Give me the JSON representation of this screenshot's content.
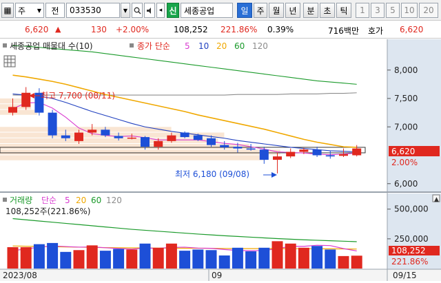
{
  "toolbar": {
    "market": "주",
    "prev_label": "전",
    "code": "033530",
    "new_label": "신",
    "stock_name": "세종공업",
    "periods": [
      "일",
      "주",
      "월",
      "년",
      "분",
      "초",
      "틱"
    ],
    "active_period": "일",
    "intervals": [
      "1",
      "3",
      "5",
      "10",
      "20"
    ]
  },
  "quote": {
    "price": "6,620",
    "change": "130",
    "change_pct": "+2.00%",
    "volume": "108,252",
    "volume_ratio": "221.86%",
    "turnover": "0.39%",
    "amount": "716백만",
    "ask_label": "호가",
    "ask_price": "6,620"
  },
  "price_panel": {
    "legend_name": "세종공업 매물대 수(10)",
    "ma_label": "종가 단순",
    "ma_periods": [
      "5",
      "10",
      "20",
      "60",
      "120"
    ],
    "high_annotation": "최고 7,700 (08/11)",
    "low_annotation": "최저 6,180 (09/08)",
    "y_ticks": [
      "8,000",
      "7,500",
      "7,000",
      "6,000"
    ],
    "current_price_tag": "6,620",
    "current_pct_tag": "2.00%"
  },
  "volume_panel": {
    "legend_name": "거래량",
    "ma_label": "단순",
    "ma_periods": [
      "5",
      "20",
      "60",
      "120"
    ],
    "volume_label": "108,252주(221.86%)",
    "y_ticks": [
      "500,000",
      "250,000"
    ],
    "current_volume_tag": "108,252",
    "current_pct_tag": "221.86%"
  },
  "x_axis": [
    "2023/08",
    "09",
    "09/15"
  ],
  "colors": {
    "up": "#e0281f",
    "down": "#1d4fd7",
    "ma5": "#d93bd0",
    "ma10": "#1f3fbf",
    "ma20": "#f0a800",
    "ma60": "#1a9a2a",
    "ma120": "#8c8c8c",
    "price_tag": "#e0281f",
    "axis_bg": "#dde6f0"
  },
  "chart_data": {
    "type": "candlestick",
    "candles": [
      {
        "o": 7250,
        "h": 7500,
        "l": 7200,
        "c": 7350
      },
      {
        "o": 7350,
        "h": 7700,
        "l": 7300,
        "c": 7600
      },
      {
        "o": 7600,
        "h": 7680,
        "l": 7200,
        "c": 7250
      },
      {
        "o": 7250,
        "h": 7300,
        "l": 6800,
        "c": 6850
      },
      {
        "o": 6850,
        "h": 6950,
        "l": 6750,
        "c": 6800
      },
      {
        "o": 6750,
        "h": 6950,
        "l": 6700,
        "c": 6900
      },
      {
        "o": 6900,
        "h": 7050,
        "l": 6850,
        "c": 6950
      },
      {
        "o": 6950,
        "h": 7000,
        "l": 6820,
        "c": 6850
      },
      {
        "o": 6840,
        "h": 6900,
        "l": 6760,
        "c": 6800
      },
      {
        "o": 6800,
        "h": 6880,
        "l": 6780,
        "c": 6810
      },
      {
        "o": 6820,
        "h": 6840,
        "l": 6600,
        "c": 6650
      },
      {
        "o": 6650,
        "h": 6800,
        "l": 6600,
        "c": 6750
      },
      {
        "o": 6750,
        "h": 6900,
        "l": 6720,
        "c": 6850
      },
      {
        "o": 6900,
        "h": 6920,
        "l": 6800,
        "c": 6820
      },
      {
        "o": 6850,
        "h": 6880,
        "l": 6750,
        "c": 6770
      },
      {
        "o": 6800,
        "h": 6850,
        "l": 6650,
        "c": 6680
      },
      {
        "o": 6680,
        "h": 6750,
        "l": 6600,
        "c": 6640
      },
      {
        "o": 6650,
        "h": 6720,
        "l": 6550,
        "c": 6620
      },
      {
        "o": 6620,
        "h": 6700,
        "l": 6580,
        "c": 6600
      },
      {
        "o": 6600,
        "h": 6650,
        "l": 6350,
        "c": 6420
      },
      {
        "o": 6420,
        "h": 6550,
        "l": 6180,
        "c": 6480
      },
      {
        "o": 6480,
        "h": 6620,
        "l": 6450,
        "c": 6560
      },
      {
        "o": 6560,
        "h": 6630,
        "l": 6520,
        "c": 6600
      },
      {
        "o": 6600,
        "h": 6650,
        "l": 6470,
        "c": 6500
      },
      {
        "o": 6500,
        "h": 6580,
        "l": 6440,
        "c": 6480
      },
      {
        "o": 6490,
        "h": 6620,
        "l": 6470,
        "c": 6520
      },
      {
        "o": 6500,
        "h": 6680,
        "l": 6480,
        "c": 6620
      }
    ],
    "volume": [
      180000,
      180000,
      205000,
      215000,
      140000,
      155000,
      195000,
      150000,
      165000,
      160000,
      210000,
      175000,
      210000,
      150000,
      160000,
      155000,
      110000,
      175000,
      145000,
      175000,
      230000,
      210000,
      175000,
      190000,
      160000,
      105000,
      108252
    ],
    "ma": {
      "ma5": [
        7320,
        7420,
        7430,
        7330,
        7170,
        6980,
        6880,
        6850,
        6830,
        6840,
        6810,
        6770,
        6770,
        6770,
        6770,
        6740,
        6710,
        6690,
        6650,
        6610,
        6560,
        6550,
        6540,
        6520,
        6510,
        6520,
        6540
      ],
      "ma10": [
        7580,
        7560,
        7540,
        7500,
        7430,
        7350,
        7270,
        7200,
        7130,
        7060,
        7000,
        6960,
        6920,
        6890,
        6860,
        6830,
        6800,
        6760,
        6730,
        6700,
        6670,
        6640,
        6620,
        6600,
        6580,
        6570,
        6560
      ],
      "ma20": [
        7910,
        7880,
        7840,
        7800,
        7750,
        7690,
        7630,
        7570,
        7520,
        7470,
        7420,
        7370,
        7320,
        7270,
        7210,
        7160,
        7110,
        7060,
        7010,
        6960,
        6900,
        6840,
        6780,
        6730,
        6690,
        6650,
        6640
      ],
      "ma60": [
        8430,
        8420,
        8400,
        8380,
        8360,
        8340,
        8320,
        8290,
        8260,
        8230,
        8200,
        8170,
        8140,
        8110,
        8080,
        8050,
        8020,
        7990,
        7960,
        7930,
        7900,
        7870,
        7840,
        7810,
        7790,
        7770,
        7750
      ],
      "ma120": [
        7560,
        7560,
        7560,
        7560,
        7560,
        7560,
        7560,
        7560,
        7560,
        7560,
        7560,
        7560,
        7560,
        7560,
        7560,
        7560,
        7560,
        7570,
        7570,
        7570,
        7570,
        7580,
        7580,
        7580,
        7590,
        7590,
        7600
      ]
    },
    "volume_ma": {
      "ma5": [
        150000,
        165000,
        180000,
        190000,
        185000,
        180000,
        182000,
        175000,
        168000,
        163000,
        172000,
        170000,
        178000,
        180000,
        172000,
        170000,
        160000,
        152000,
        150000,
        152000,
        167000,
        187000,
        187000,
        196000,
        193000,
        168000,
        148000
      ],
      "ma20": [
        190000,
        188000,
        186000,
        184000,
        182000,
        180000,
        178000,
        176000,
        175000,
        174000,
        173000,
        172000,
        172000,
        171000,
        171000,
        170000,
        169000,
        168000,
        168000,
        168000,
        168000,
        167000,
        167000,
        166000,
        166000,
        165000,
        164000
      ],
      "ma60": [
        420000,
        410000,
        400000,
        390000,
        380000,
        370000,
        360000,
        350000,
        340000,
        330000,
        322000,
        314000,
        306000,
        298000,
        290000,
        283000,
        276000,
        270000,
        264000,
        258000,
        252000,
        247000,
        242000,
        238000,
        234000,
        230000,
        226000
      ]
    },
    "volume_profile": [
      {
        "low": 6400,
        "high": 6500,
        "weight": 0.85
      },
      {
        "low": 6500,
        "high": 6600,
        "weight": 0.9
      },
      {
        "low": 6600,
        "high": 6700,
        "weight": 0.8
      },
      {
        "low": 6700,
        "high": 6800,
        "weight": 0.7
      },
      {
        "low": 6800,
        "high": 6900,
        "weight": 0.72
      },
      {
        "low": 6900,
        "high": 7000,
        "weight": 0.55
      },
      {
        "low": 7200,
        "high": 7300,
        "weight": 0.12
      },
      {
        "low": 7300,
        "high": 7400,
        "weight": 0.1
      },
      {
        "low": 7400,
        "high": 7500,
        "weight": 0.08
      }
    ],
    "ylim": [
      5900,
      8300
    ],
    "volume_ylim": [
      0,
      620000
    ]
  }
}
